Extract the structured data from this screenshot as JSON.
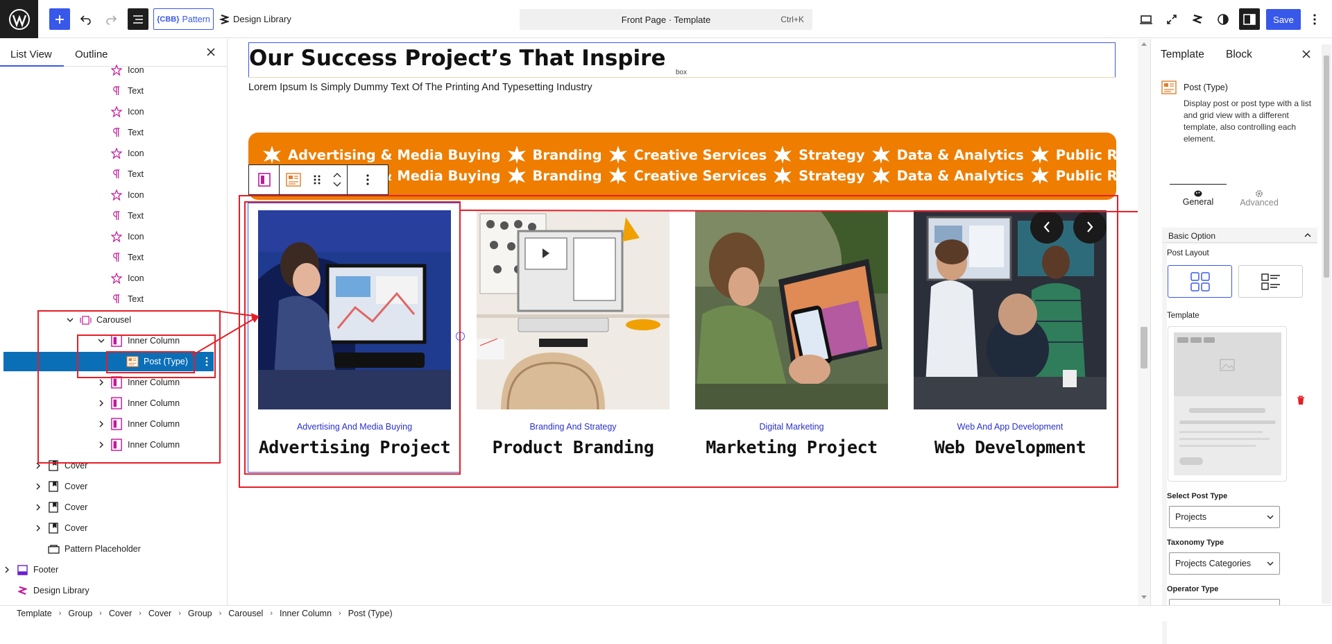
{
  "topbar": {
    "pattern_label": "Pattern",
    "cbb_badge": "{CBB}",
    "design_library_label": "Design Library",
    "command_title": "Front Page · Template",
    "command_shortcut": "Ctrl+K",
    "save_label": "Save"
  },
  "left_panel": {
    "tabs": [
      "List View",
      "Outline"
    ],
    "rows": [
      {
        "label": "Icon",
        "icon": "star-icon",
        "indent": 1
      },
      {
        "label": "Text",
        "icon": "paragraph-icon",
        "indent": 1
      },
      {
        "label": "Icon",
        "icon": "star-icon",
        "indent": 1
      },
      {
        "label": "Text",
        "icon": "paragraph-icon",
        "indent": 1
      },
      {
        "label": "Icon",
        "icon": "star-icon",
        "indent": 1
      },
      {
        "label": "Text",
        "icon": "paragraph-icon",
        "indent": 1
      },
      {
        "label": "Icon",
        "icon": "star-icon",
        "indent": 1
      },
      {
        "label": "Text",
        "icon": "paragraph-icon",
        "indent": 1
      },
      {
        "label": "Icon",
        "icon": "star-icon",
        "indent": 1
      },
      {
        "label": "Text",
        "icon": "paragraph-icon",
        "indent": 1
      },
      {
        "label": "Icon",
        "icon": "star-icon",
        "indent": 1
      },
      {
        "label": "Text",
        "icon": "paragraph-icon",
        "indent": 1
      },
      {
        "label": "Carousel",
        "icon": "carousel-icon",
        "indent": 0,
        "chevron": "down"
      },
      {
        "label": "Inner Column",
        "icon": "column-icon",
        "indent": 1,
        "chevron": "down"
      },
      {
        "label": "Post (Type)",
        "icon": "post-type-icon",
        "indent": 2,
        "selected": true
      },
      {
        "label": "Inner Column",
        "icon": "column-icon",
        "indent": 1,
        "chevron": "right"
      },
      {
        "label": "Inner Column",
        "icon": "column-icon",
        "indent": 1,
        "chevron": "right"
      },
      {
        "label": "Inner Column",
        "icon": "column-icon",
        "indent": 1,
        "chevron": "right"
      },
      {
        "label": "Inner Column",
        "icon": "column-icon",
        "indent": 1,
        "chevron": "right"
      },
      {
        "label": "Cover",
        "icon": "cover-icon",
        "indent": -1,
        "chevron": "right"
      },
      {
        "label": "Cover",
        "icon": "cover-icon",
        "indent": -1,
        "chevron": "right"
      },
      {
        "label": "Cover",
        "icon": "cover-icon",
        "indent": -1,
        "chevron": "right"
      },
      {
        "label": "Cover",
        "icon": "cover-icon",
        "indent": -1,
        "chevron": "right"
      },
      {
        "label": "Pattern Placeholder",
        "icon": "placeholder-icon",
        "indent": -1
      },
      {
        "label": "Footer",
        "icon": "footer-icon",
        "indent": -2,
        "chevron": "right"
      },
      {
        "label": "Design Library",
        "icon": "design-library-icon",
        "indent": -2
      }
    ]
  },
  "canvas": {
    "heading": "Our Success Project’s That Inspire",
    "heading_tag_hint": "box",
    "subtext": "Lorem Ipsum Is Simply Dummy Text Of The Printing And Typesetting Industry",
    "banner_items": [
      "Advertising & Media Buying",
      "Branding",
      "Creative Services",
      "Strategy",
      "Data & Analytics",
      "Public Relations"
    ],
    "cards": [
      {
        "category": "Advertising And Media Buying",
        "title": "Advertising Project"
      },
      {
        "category": "Branding And Strategy",
        "title": "Product Branding"
      },
      {
        "category": "Digital Marketing",
        "title": "Marketing Project"
      },
      {
        "category": "Web And App Development",
        "title": "Web Development"
      }
    ]
  },
  "right_panel": {
    "tabs": [
      "Template",
      "Block"
    ],
    "block_name": "Post (Type)",
    "block_desc": "Display post or post type with a list and grid view with a different template, also controlling each element.",
    "sub_tabs": [
      "General",
      "Advanced"
    ],
    "section_title": "Basic Option",
    "post_layout_label": "Post Layout",
    "template_label": "Template",
    "select_post_type_label": "Select Post Type",
    "select_post_type_value": "Projects",
    "taxonomy_type_label": "Taxonomy Type",
    "taxonomy_type_value": "Projects Categories",
    "operator_type_label": "Operator Type"
  },
  "breadcrumbs": [
    "Template",
    "Group",
    "Cover",
    "Cover",
    "Group",
    "Carousel",
    "Inner Column",
    "Post (Type)"
  ]
}
